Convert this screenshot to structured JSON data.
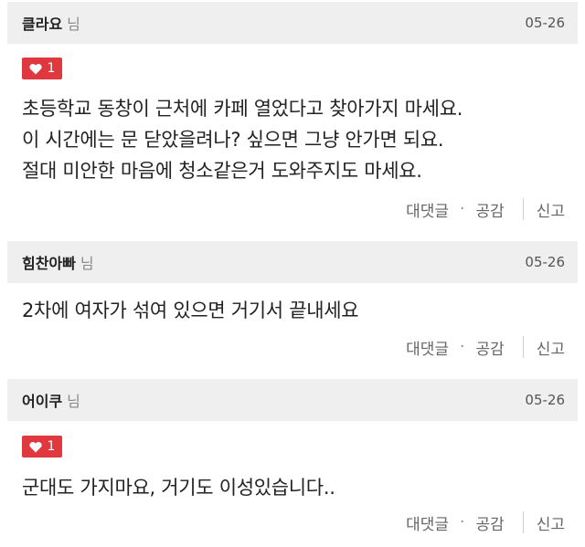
{
  "comments": [
    {
      "author": "클라요",
      "author_suffix": "님",
      "date": "05-26",
      "likes": "1",
      "lines": [
        "초등학교 동창이 근처에 카페 열었다고 찾아가지 마세요.",
        "이 시간에는 문 닫았을려나? 싶으면 그냥 안가면 되요.",
        "절대 미안한 마음에 청소같은거 도와주지도 마세요."
      ],
      "reply_label": "대댓글",
      "separator": "·",
      "empathy_label": "공감",
      "report_label": "신고"
    },
    {
      "author": "힘찬아빠",
      "author_suffix": "님",
      "date": "05-26",
      "lines": [
        "2차에 여자가 섞여 있으면 거기서 끝내세요"
      ],
      "reply_label": "대댓글",
      "separator": "·",
      "empathy_label": "공감",
      "report_label": "신고"
    },
    {
      "author": "어이쿠",
      "author_suffix": "님",
      "date": "05-26",
      "likes": "1",
      "lines": [
        "군대도 가지마요, 거기도 이성있습니다.."
      ],
      "reply_label": "대댓글",
      "separator": "·",
      "empathy_label": "공감",
      "report_label": "신고"
    }
  ],
  "colors": {
    "header_bg": "#efefef",
    "like_badge": "#e0383f",
    "text": "#222222",
    "muted": "#666666"
  },
  "icons": {
    "like": "heart-icon"
  }
}
